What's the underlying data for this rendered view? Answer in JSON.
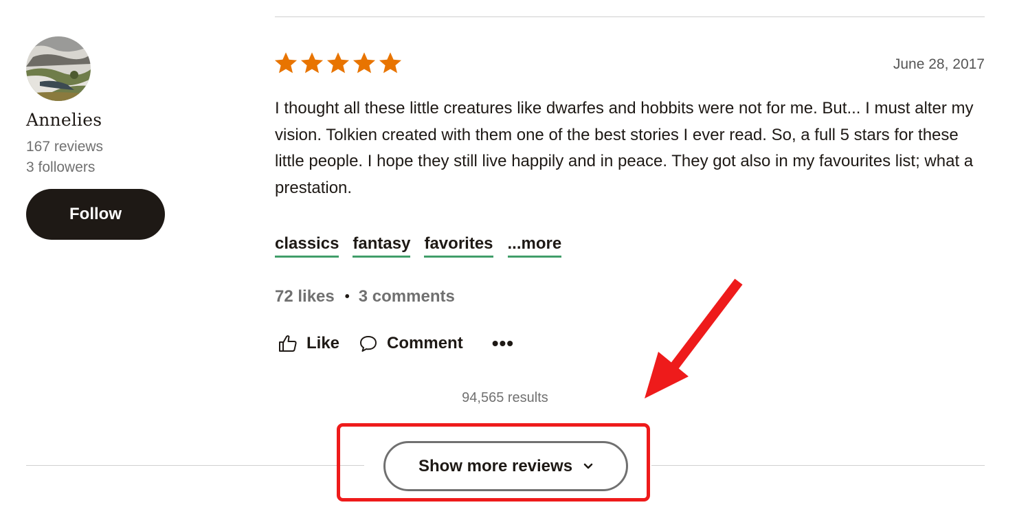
{
  "reviewer": {
    "name": "Annelies",
    "reviews": "167 reviews",
    "followers": "3 followers",
    "follow_label": "Follow"
  },
  "review": {
    "rating": 5,
    "star_color": "#e87400",
    "date": "June 28, 2017",
    "text": "I thought all these little creatures like dwarfes and hobbits were not for me. But... I must alter my vision. Tolkien created with them one of the best stories I ever read. So, a full 5 stars for these little people. I hope they still live happily and in peace. They got also in my favourites list; what a prestation.",
    "tags": [
      "classics",
      "fantasy",
      "favorites",
      "...more"
    ],
    "likes": "72 likes",
    "comments": "3 comments",
    "actions": {
      "like_label": "Like",
      "comment_label": "Comment",
      "more_label": "•••"
    }
  },
  "results": "94,565 results",
  "show_more_label": "Show more reviews",
  "colors": {
    "accent_underline": "#409d69",
    "annotation_red": "#ee1b1b",
    "primary_dark": "#1e1915"
  }
}
